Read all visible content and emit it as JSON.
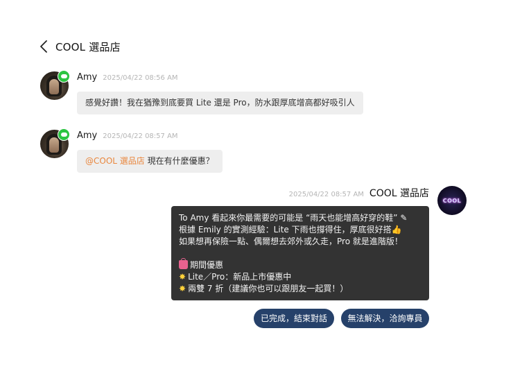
{
  "header": {
    "title": "COOL 選品店"
  },
  "messages": [
    {
      "sender": "Amy",
      "time": "2025/04/22 08:56 AM",
      "text": "感覺好讚！我在猶豫到底要買 Lite 還是 Pro，防水跟厚底增高都好吸引人"
    },
    {
      "sender": "Amy",
      "time": "2025/04/22 08:57 AM",
      "mention": "@COOL 選品店",
      "text": " 現在有什麼優惠？"
    }
  ],
  "reply": {
    "sender": "COOL 選品店",
    "time": "2025/04/22 08:57 AM",
    "avatar_text": "COOL",
    "lines": [
      "To Amy 看起來你最需要的可能是 “雨天也能增高好穿的鞋” ✎",
      "根據 Emily 的實測經驗：Lite 下雨也撐得住，厚底很好搭👍",
      "如果想再保險一點、偶爾想去郊外或久走，Pro 就是進階版！",
      "",
      "期間優惠",
      "Lite／Pro：新品上市優惠中",
      "兩雙 7 折（建議你也可以跟朋友一起買！）"
    ]
  },
  "actions": {
    "done_label": "已完成，結束對話",
    "agent_label": "無法解決，洽詢專員"
  },
  "colors": {
    "mention": "#e9873e",
    "reply_bubble": "#333333",
    "incoming_bubble": "#eeeeee",
    "action_button": "#26416a",
    "line_badge": "#2cc441"
  }
}
